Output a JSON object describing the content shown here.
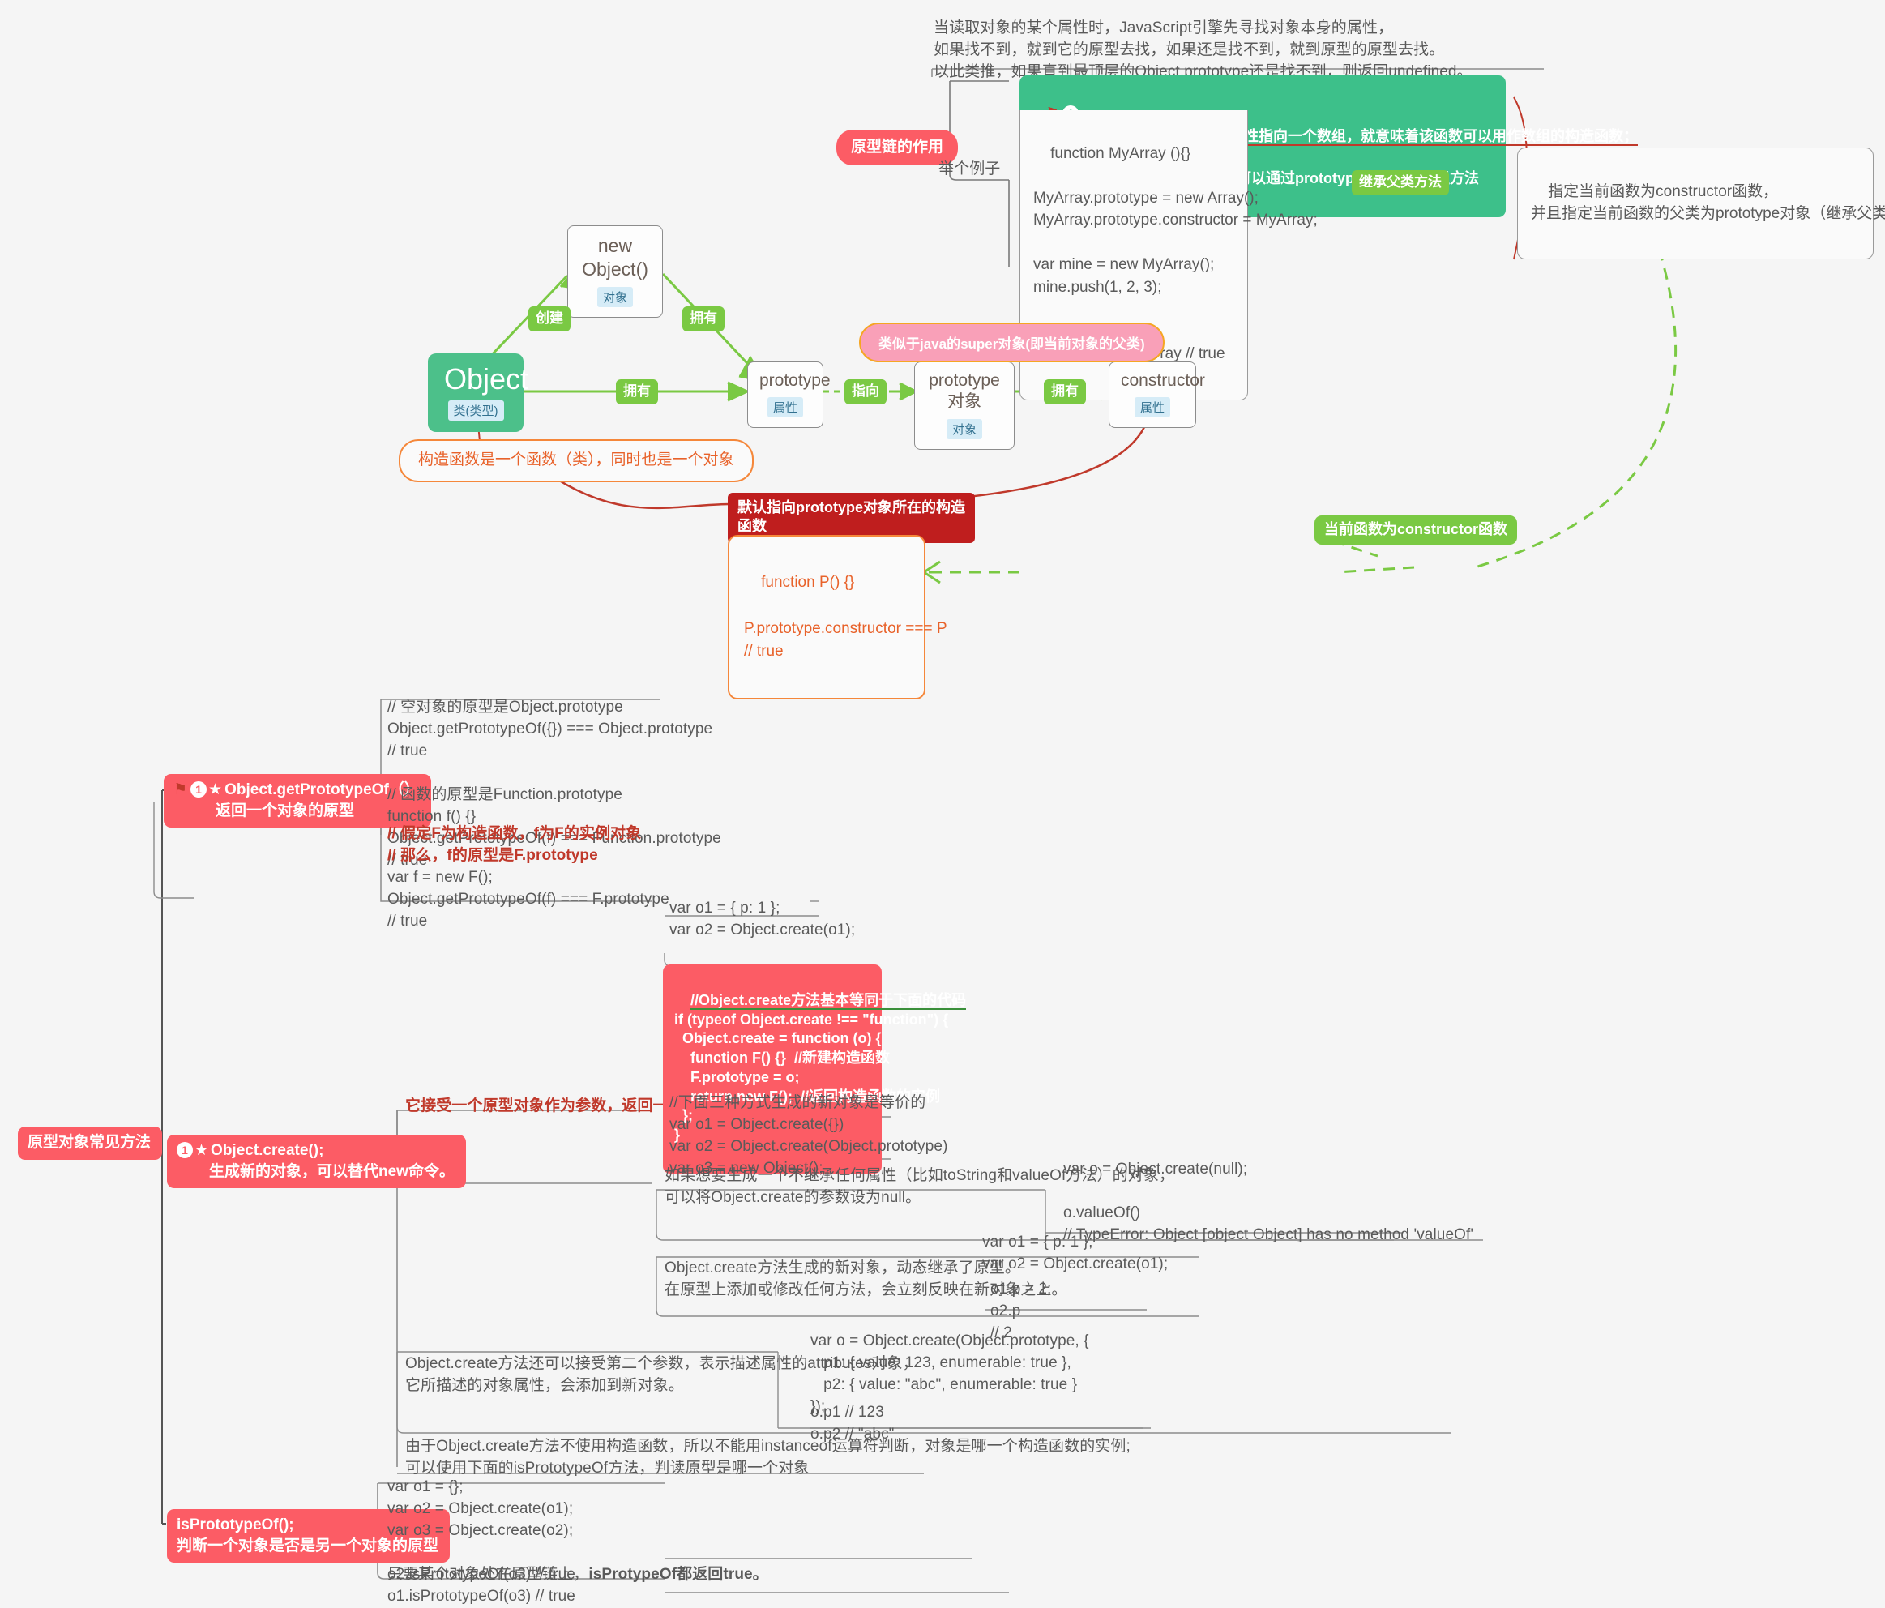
{
  "theme": {
    "bg": "#f5f5f5",
    "pink": "#fc5c65",
    "green": "#7ac943",
    "teal": "#3dc08a",
    "dark_red": "#bf1e1e",
    "orange": "#f5873a",
    "text": "#5a5a5a"
  },
  "top": {
    "intro_note": "当读取对象的某个属性时，JavaScript引擎先寻找对象本身的属性，\n如果找不到，就到它的原型去找，如果还是找不到，就到原型的原型去找。\n以此类推，如果直到最顶层的Object.prototype还是找不到，则返回undefined。",
    "topic_label": "原型链的作用",
    "example_label": "举个例子",
    "green_banner": {
      "num": "1",
      "flag": "⚑",
      "line1": "如果让某个函数的prototype属性指向一个数组，就意味着该函数可以用作数组的构造函数；",
      "line2": "因为它生成的实例对象都可以通过prototype属性调用数组方法"
    },
    "code_myarray": "function MyArray (){}\n\nMyArray.prototype = new Array();\nMyArray.prototype.constructor = MyArray;\n\nvar mine = new MyArray();\nmine.push(1, 2, 3);\n\nmine.length // 3\nmine instanceof Array // true",
    "edge_inherit": "继承父类方法",
    "right_note": "指定当前函数为constructor函数，\n并且指定当前函数的父类为prototype对象（继承父类的方法）"
  },
  "graph": {
    "new_object": {
      "title": "new Object()",
      "tag": "对象"
    },
    "object": {
      "title": "Object",
      "tag": "类(类型)"
    },
    "prototype": {
      "title": "prototype",
      "tag": "属性"
    },
    "prototype_obj": {
      "title": "prototype对象",
      "tag": "对象"
    },
    "constructor": {
      "title": "constructor",
      "tag": "属性"
    },
    "edges": {
      "create": "创建",
      "own1": "拥有",
      "own2": "拥有",
      "point_to": "指向",
      "own3": "拥有"
    },
    "super_note": "类似于java的super对象(即当前对象的父类)",
    "ctor_note": "构造函数是一个函数（类），同时也是一个对象",
    "default_point": "默认指向prototype对象所在的构造\n函数",
    "code_p": "function P() {}\n\nP.prototype.constructor === P\n// true",
    "edge_current_ctor": "当前函数为constructor函数"
  },
  "bottom": {
    "root_label": "原型对象常见方法",
    "getprototypeof": {
      "flag": "⚑",
      "num": "1",
      "star": "★",
      "title": "Object.getPrototypeOf（）",
      "subtitle": "返回一个对象的原型",
      "code": "// 空对象的原型是Object.prototype\nObject.getPrototypeOf({}) === Object.prototype\n// true\n\n// 函数的原型是Function.prototype\nfunction f() {}\nObject.getPrototypeOf(f) === Function.prototype\n// true\n",
      "code_hl_line1": "// 假定F为构造函数，f为F的实例对象",
      "code_hl_line2": "// 那么，f的原型是F.prototype",
      "code_tail": "var f = new F();\nObject.getPrototypeOf(f) === F.prototype\n// true"
    },
    "create": {
      "num": "1",
      "star": "★",
      "title": "Object.create();",
      "subtitle": "生成新的对象，可以替代new命令。",
      "branch1_label": "它接受一个原型对象作为参数，返回一个新对象",
      "code_o1_o2": "var o1 = { p: 1 };\nvar o2 = Object.create(o1);\n\no2.p // 1",
      "red_code": {
        "title": "//Object.create方法基本等同于下面的代码",
        "body": "if (typeof Object.create !== \"function\") {\n  Object.create = function (o) {\n    function F() {}  //新建构造函数\n    F.prototype = o;\n    return new F();  //返回构造函数的实例\n  };\n}"
      },
      "code_three_ways": "//下面三种方式生成的新对象是等价的\nvar o1 = Object.create({})\nvar o2 = Object.create(Object.prototype)\nvar o3 = new Object();",
      "note_null": "如果想要生成一个不继承任何属性（比如toString和valueOf方法）的对象，\n可以将Object.create的参数设为null。",
      "code_null": "var o = Object.create(null);\n\no.valueOf()\n// TypeError: Object [object Object] has no method 'valueOf'",
      "note_dynamic": "Object.create方法生成的新对象，动态继承了原型。\n在原型上添加或修改任何方法，会立刻反映在新对象之上。",
      "code_dynamic_left": "var o1 = { p: 1 };\nvar o2 = Object.create(o1);",
      "code_dynamic_right": "o1.p = 2;\no2.p\n// 2",
      "note_second_arg": "Object.create方法还可以接受第二个参数，表示描述属性的attributes对象，\n它所描述的对象属性，会添加到新对象。",
      "code_second_arg": "var o = Object.create(Object.prototype, {\n   p1: { value: 123, enumerable: true },\n   p2: { value: \"abc\", enumerable: true }\n});",
      "code_second_arg_result": "o.p1 // 123\no.p2 // \"abc\"",
      "note_instanceof": "由于Object.create方法不使用构造函数，所以不能用instanceof运算符判断，对象是哪一个构造函数的实例;\n可以使用下面的isPrototypeOf方法，判读原型是哪一个对象"
    },
    "isprototypeof": {
      "title": "isPrototypeOf();",
      "subtitle": "判断一个对象是否是另一个对象的原型",
      "code": "var o1 = {};\nvar o2 = Object.create(o1);\nvar o3 = Object.create(o2);\n\no2.isPrototypeOf(o3) // true\no1.isPrototypeOf(o3) // true",
      "conclusion_plain": "只要某个对象处在原型链上，",
      "conclusion_bold": "isProtypeOf都返回true。"
    }
  }
}
